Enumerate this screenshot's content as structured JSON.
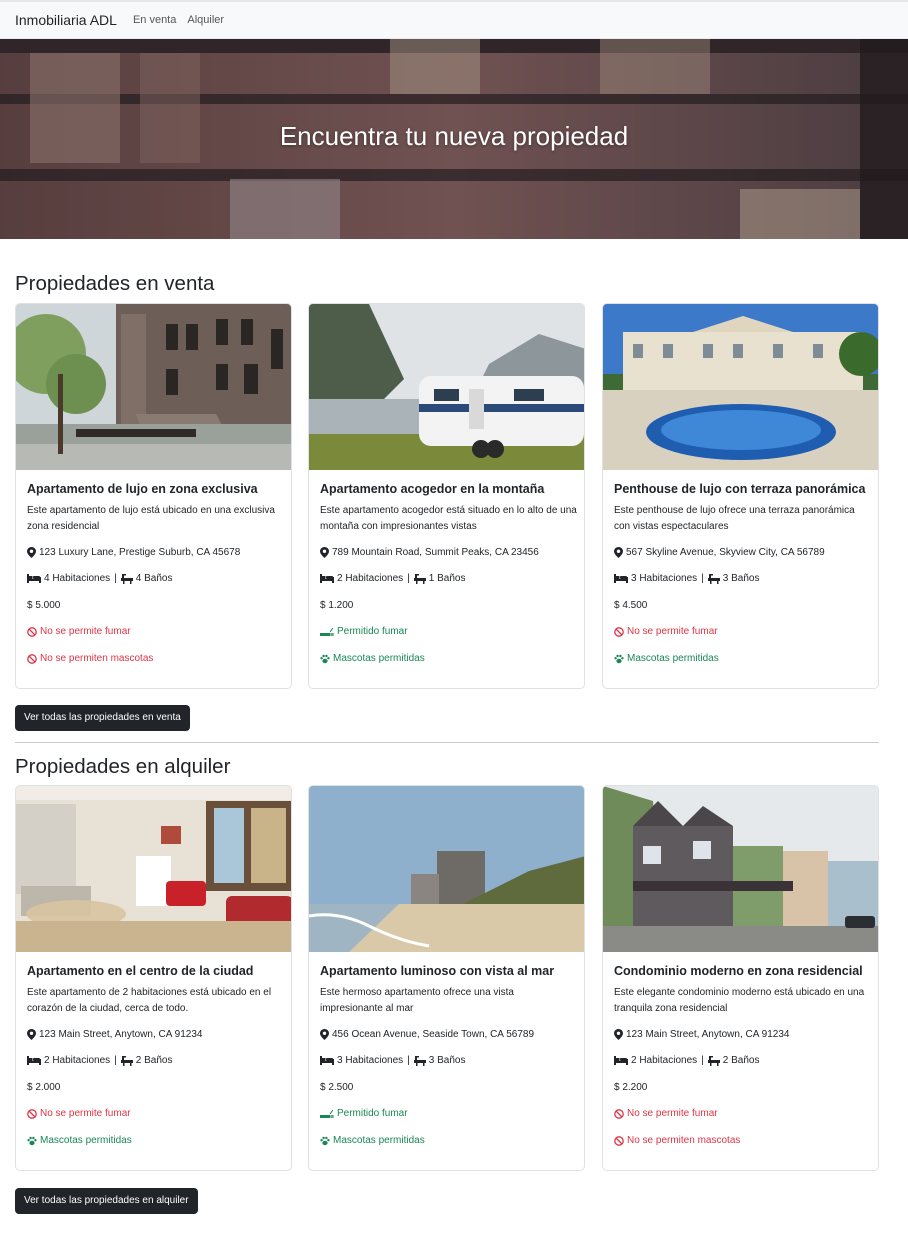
{
  "navbar": {
    "brand": "Inmobiliaria ADL",
    "links": [
      "En venta",
      "Alquiler"
    ]
  },
  "hero": {
    "title": "Encuentra tu nueva propiedad"
  },
  "sale": {
    "title": "Propiedades en venta",
    "button": "Ver todas las propiedades en venta",
    "cards": [
      {
        "title": "Apartamento de lujo en zona exclusiva",
        "description": "Este apartamento de lujo está ubicado en una exclusiva zona residencial",
        "address": "123 Luxury Lane, Prestige Suburb, CA 45678",
        "rooms": "4 Habitaciones",
        "baths": "4 Baños",
        "price": "$ 5.000",
        "smoking": "No se permite fumar",
        "pets": "No se permiten mascotas"
      },
      {
        "title": "Apartamento acogedor en la montaña",
        "description": "Este apartamento acogedor está situado en lo alto de una montaña con impresionantes vistas",
        "address": "789 Mountain Road, Summit Peaks, CA 23456",
        "rooms": "2 Habitaciones",
        "baths": "1 Baños",
        "price": "$ 1.200",
        "smoking": "Permitido fumar",
        "pets": "Mascotas permitidas"
      },
      {
        "title": "Penthouse de lujo con terraza panorámica",
        "description": "Este penthouse de lujo ofrece una terraza panorámica con vistas espectaculares",
        "address": "567 Skyline Avenue, Skyview City, CA 56789",
        "rooms": "3 Habitaciones",
        "baths": "3 Baños",
        "price": "$ 4.500",
        "smoking": "No se permite fumar",
        "pets": "Mascotas permitidas"
      }
    ]
  },
  "rent": {
    "title": "Propiedades en alquiler",
    "button": "Ver todas las propiedades en alquiler",
    "cards": [
      {
        "title": "Apartamento en el centro de la ciudad",
        "description": "Este apartamento de 2 habitaciones está ubicado en el corazón de la ciudad, cerca de todo.",
        "address": "123 Main Street, Anytown, CA 91234",
        "rooms": "2 Habitaciones",
        "baths": "2 Baños",
        "price": "$ 2.000",
        "smoking": "No se permite fumar",
        "pets": "Mascotas permitidas"
      },
      {
        "title": "Apartamento luminoso con vista al mar",
        "description": "Este hermoso apartamento ofrece una vista impresionante al mar",
        "address": "456 Ocean Avenue, Seaside Town, CA 56789",
        "rooms": "3 Habitaciones",
        "baths": "3 Baños",
        "price": "$ 2.500",
        "smoking": "Permitido fumar",
        "pets": "Mascotas permitidas"
      },
      {
        "title": "Condominio moderno en zona residencial",
        "description": "Este elegante condominio moderno está ubicado en una tranquila zona residencial",
        "address": "123 Main Street, Anytown, CA 91234",
        "rooms": "2 Habitaciones",
        "baths": "2 Baños",
        "price": "$ 2.200",
        "smoking": "No se permite fumar",
        "pets": "No se permiten mascotas"
      }
    ]
  },
  "colors": {
    "allowed": "#198754",
    "not_allowed": "#dc3545",
    "button": "#212529"
  },
  "icons": [
    "map-marker-icon",
    "bed-icon",
    "bath-icon",
    "ban-icon",
    "smoking-icon",
    "paw-icon"
  ]
}
